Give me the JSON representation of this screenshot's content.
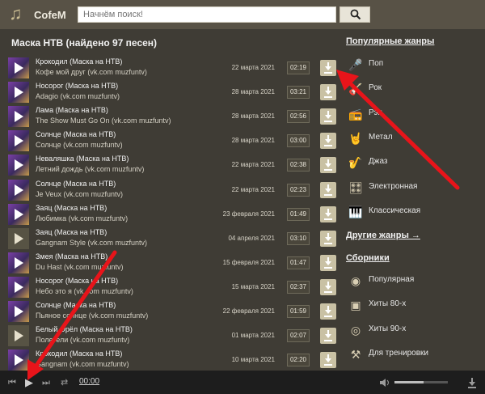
{
  "app": {
    "logo_text": "CofeM",
    "logo_icon": "music-note-icon"
  },
  "search": {
    "placeholder": "Начнём поиск!"
  },
  "results": {
    "title": "Маска НТВ (найдено 97 песен)",
    "tracks": [
      {
        "title": "Крокодил (Маска на НТВ)",
        "artist": "Кофе мой друг (vk.com muzfuntv)",
        "date": "22 марта 2021",
        "duration": "02:19",
        "thumb": "cover"
      },
      {
        "title": "Носорог (Маска на НТВ)",
        "artist": "Adagio (vk.com muzfuntv)",
        "date": "28 марта 2021",
        "duration": "03:21",
        "thumb": "cover"
      },
      {
        "title": "Лама (Маска на НТВ)",
        "artist": "The Show Must Go On (vk.com muzfuntv)",
        "date": "28 марта 2021",
        "duration": "02:56",
        "thumb": "cover"
      },
      {
        "title": "Солнце (Маска на НТВ)",
        "artist": "Солнце (vk.com muzfuntv)",
        "date": "28 марта 2021",
        "duration": "03:00",
        "thumb": "cover"
      },
      {
        "title": "Неваляшка (Маска на НТВ)",
        "artist": "Летний дождь (vk.com muzfuntv)",
        "date": "22 марта 2021",
        "duration": "02:38",
        "thumb": "cover"
      },
      {
        "title": "Солнце (Маска на НТВ)",
        "artist": "Je Veux (vk.com muzfuntv)",
        "date": "22 марта 2021",
        "duration": "02:23",
        "thumb": "cover"
      },
      {
        "title": "Заяц (Маска на НТВ)",
        "artist": "Любимка (vk.com muzfuntv)",
        "date": "23 февраля 2021",
        "duration": "01:49",
        "thumb": "cover"
      },
      {
        "title": "Заяц (Маска на НТВ)",
        "artist": "Gangnam Style (vk.com muzfuntv)",
        "date": "04 апреля 2021",
        "duration": "03:10",
        "thumb": "plain"
      },
      {
        "title": "Змея (Маска на НТВ)",
        "artist": "Du Hast (vk.com muzfuntv)",
        "date": "15 февраля 2021",
        "duration": "01:47",
        "thumb": "cover"
      },
      {
        "title": "Носорог (Маска на НТВ)",
        "artist": "Небо это я (vk.com muzfuntv)",
        "date": "15 марта 2021",
        "duration": "02:37",
        "thumb": "cover"
      },
      {
        "title": "Солнце (Маска на НТВ)",
        "artist": "Пьяное солнце (vk.com muzfuntv)",
        "date": "22 февраля 2021",
        "duration": "01:59",
        "thumb": "cover"
      },
      {
        "title": "Белый Орёл (Маска на НТВ)",
        "artist": "Полетели (vk.com muzfuntv)",
        "date": "01 марта 2021",
        "duration": "02:07",
        "thumb": "plain"
      },
      {
        "title": "Крокодил (Маска на НТВ)",
        "artist": "Gangnam (vk.com muzfuntv)",
        "date": "10 марта 2021",
        "duration": "02:20",
        "thumb": "cover"
      }
    ]
  },
  "sidebar": {
    "popular_title": "Популярные жанры",
    "genres": [
      {
        "label": "Поп",
        "icon": "microphone-icon"
      },
      {
        "label": "Рок",
        "icon": "guitar-icon"
      },
      {
        "label": "Рэп",
        "icon": "boombox-icon"
      },
      {
        "label": "Метал",
        "icon": "rock-hand-icon"
      },
      {
        "label": "Джаз",
        "icon": "saxophone-icon"
      },
      {
        "label": "Электронная",
        "icon": "synth-icon"
      },
      {
        "label": "Классическая",
        "icon": "piano-icon"
      }
    ],
    "other_genres": "Другие жанры →",
    "collections_title": "Сборники",
    "collections": [
      {
        "label": "Популярная",
        "icon": "vinyl-icon"
      },
      {
        "label": "Хиты 80-х",
        "icon": "cassette-80s-icon"
      },
      {
        "label": "Хиты 90-х",
        "icon": "cd-90s-icon"
      },
      {
        "label": "Для тренировки",
        "icon": "dumbbell-icon"
      }
    ]
  },
  "player": {
    "time": "00:00",
    "volume": 0.55
  },
  "colors": {
    "accent": "#c9c1a4",
    "background": "#3f3c35",
    "topbar": "#585246",
    "annotation_arrow": "#e8141a"
  }
}
